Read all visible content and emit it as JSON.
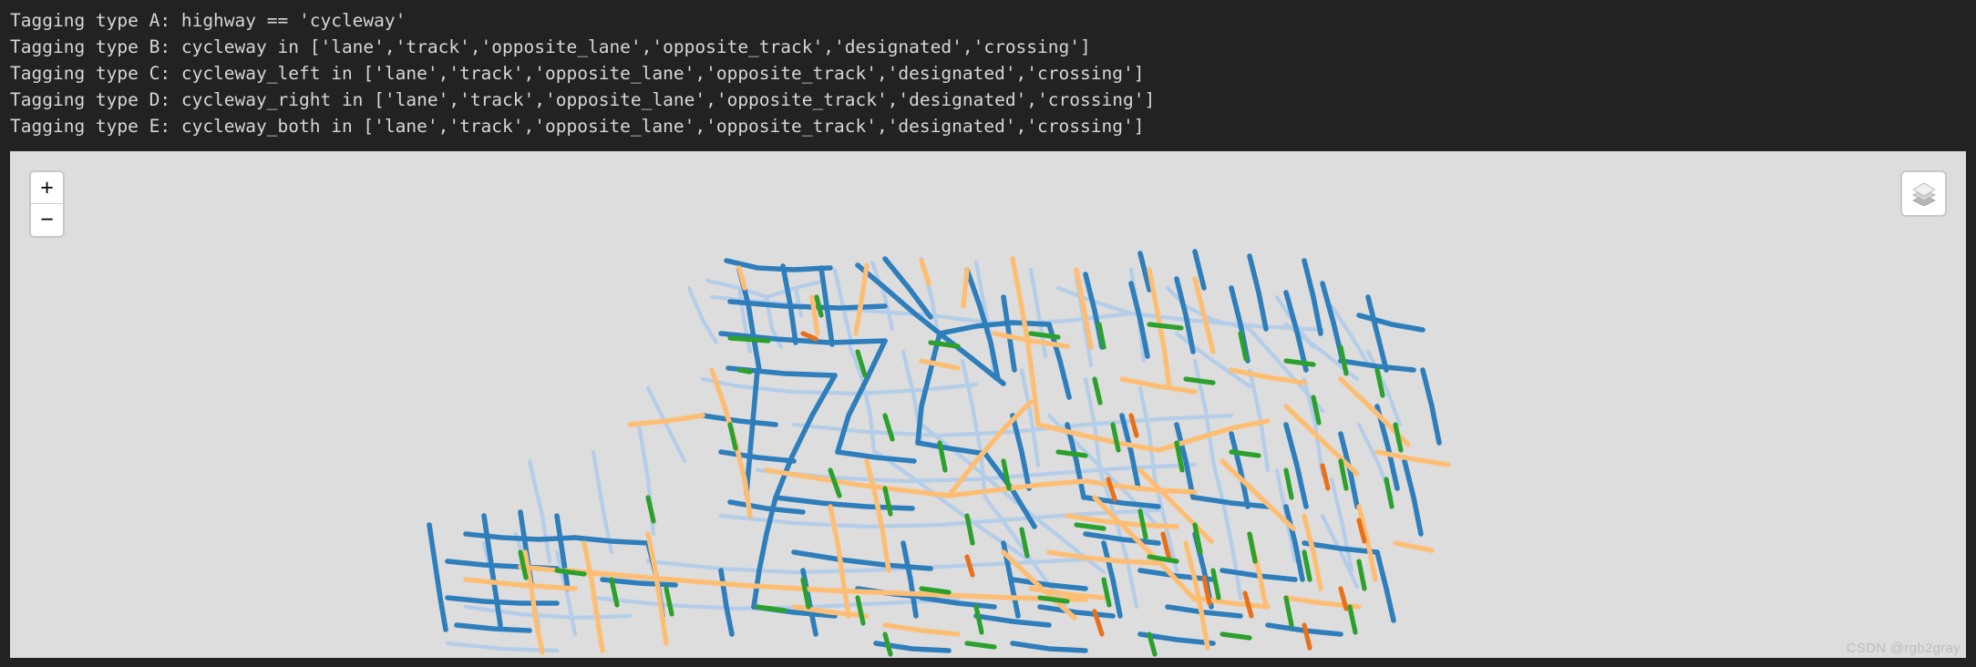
{
  "console": {
    "lines": [
      "Tagging type A: highway == 'cycleway'",
      "Tagging type B: cycleway in ['lane','track','opposite_lane','opposite_track','designated','crossing']",
      "Tagging type C: cycleway_left in ['lane','track','opposite_lane','opposite_track','designated','crossing']",
      "Tagging type D: cycleway_right in ['lane','track','opposite_lane','opposite_track','designated','crossing']",
      "Tagging type E: cycleway_both in ['lane','track','opposite_lane','opposite_track','designated','crossing']"
    ]
  },
  "map": {
    "zoom_in_label": "+",
    "zoom_out_label": "−",
    "layers_icon": "layers-stack-icon",
    "background_color": "#dddddd",
    "page_background_color": "#222222",
    "network_colors": {
      "dark_blue": "#2e7ebb",
      "light_blue": "#b4cde8",
      "orange": "#fdbe74",
      "green": "#2ca02c",
      "dark_orange": "#e8701a"
    }
  },
  "watermark": {
    "text": "CSDN @rgb2gray"
  }
}
